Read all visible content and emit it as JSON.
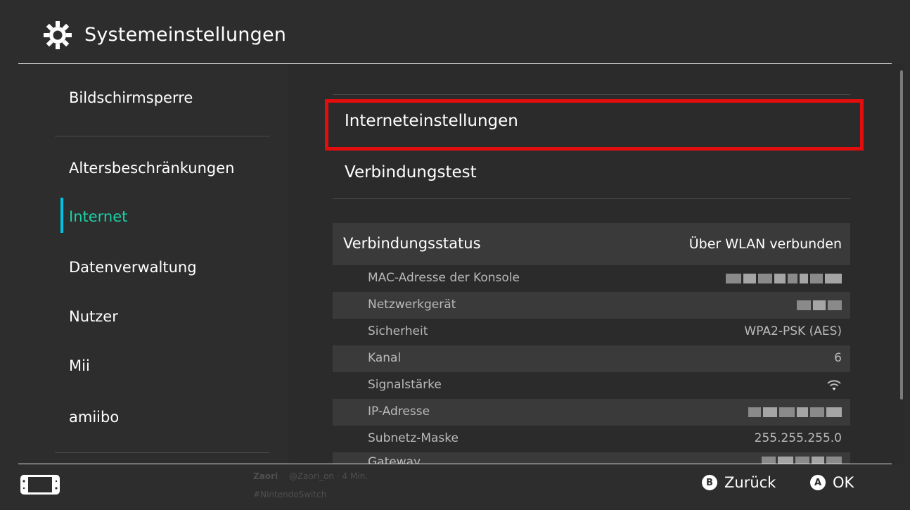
{
  "header": {
    "title": "Systemeinstellungen",
    "icon": "gear-icon"
  },
  "sidebar": {
    "items": [
      {
        "label": "Bildschirmsperre"
      },
      {
        "label": "Altersbeschränkungen"
      },
      {
        "label": "Internet",
        "active": true
      },
      {
        "label": "Datenverwaltung"
      },
      {
        "label": "Nutzer"
      },
      {
        "label": "Mii"
      },
      {
        "label": "amiibo"
      }
    ]
  },
  "main": {
    "menu": [
      {
        "label": "Interneteinstellungen",
        "highlighted": true
      },
      {
        "label": "Verbindungstest"
      }
    ],
    "status": {
      "label": "Verbindungsstatus",
      "value": "Über WLAN verbunden"
    },
    "details": [
      {
        "label": "MAC-Adresse der Konsole",
        "value": "",
        "obscured": true
      },
      {
        "label": "Netzwerkgerät",
        "value": "",
        "obscured": true
      },
      {
        "label": "Sicherheit",
        "value": "WPA2-PSK (AES)"
      },
      {
        "label": "Kanal",
        "value": "6"
      },
      {
        "label": "Signalstärke",
        "value": "",
        "icon": "wifi-signal-icon"
      },
      {
        "label": "IP-Adresse",
        "value": "",
        "obscured": true
      },
      {
        "label": "Subnetz-Maske",
        "value": "255.255.255.0"
      },
      {
        "label": "Gateway",
        "value": "",
        "obscured": true
      }
    ]
  },
  "footer": {
    "watermark": {
      "name": "Zaori",
      "handle": "@Zaori_on",
      "time": "· 4 Min.",
      "hashtag": "#NintendoSwitch"
    },
    "back": {
      "button": "B",
      "label": "Zurück"
    },
    "ok": {
      "button": "A",
      "label": "OK"
    }
  },
  "colors": {
    "background": "#2d2d2d",
    "active_text": "#19d1a6",
    "highlight_border": "#e20d0d"
  }
}
